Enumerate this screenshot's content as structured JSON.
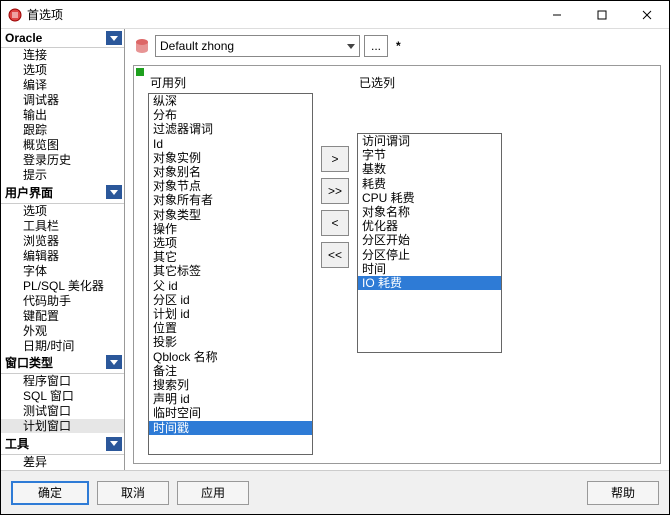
{
  "window": {
    "title": "首选项"
  },
  "sidebar": {
    "sections": [
      {
        "header": "Oracle",
        "items": [
          "连接",
          "选项",
          "编译",
          "调试器",
          "输出",
          "跟踪",
          "概览图",
          "登录历史",
          "提示"
        ]
      },
      {
        "header": "用户界面",
        "items": [
          "选项",
          "工具栏",
          "浏览器",
          "编辑器",
          "字体",
          "PL/SQL 美化器",
          "代码助手",
          "键配置",
          "外观",
          "日期/时间"
        ]
      },
      {
        "header": "窗口类型",
        "items": [
          "程序窗口",
          "SQL 窗口",
          "测试窗口",
          "计划窗口"
        ],
        "selectedIndex": 3
      },
      {
        "header": "工具",
        "items": [
          "差异"
        ]
      }
    ]
  },
  "profile": {
    "value": "Default zhong",
    "dots": "...",
    "star": "*"
  },
  "lists": {
    "available": {
      "label": "可用列",
      "items": [
        "纵深",
        "分布",
        "过滤器谓词",
        "Id",
        "对象实例",
        "对象别名",
        "对象节点",
        "对象所有者",
        "对象类型",
        "操作",
        "选项",
        "其它",
        "其它标签",
        "父 id",
        "分区 id",
        "计划 id",
        "位置",
        "投影",
        "Qblock 名称",
        "备注",
        "搜索列",
        "声明 id",
        "临时空间",
        "时间戳"
      ],
      "selectedIndex": 23
    },
    "selected": {
      "label": "已选列",
      "items": [
        "访问谓词",
        "字节",
        "基数",
        "耗费",
        "CPU 耗费",
        "对象名称",
        "优化器",
        "分区开始",
        "分区停止",
        "时间",
        "IO 耗费"
      ],
      "selectedIndex": 10
    }
  },
  "buttons": {
    "right": ">",
    "right_all": ">>",
    "left": "<",
    "left_all": "<<"
  },
  "footer": {
    "ok": "确定",
    "cancel": "取消",
    "apply": "应用",
    "help": "帮助"
  }
}
